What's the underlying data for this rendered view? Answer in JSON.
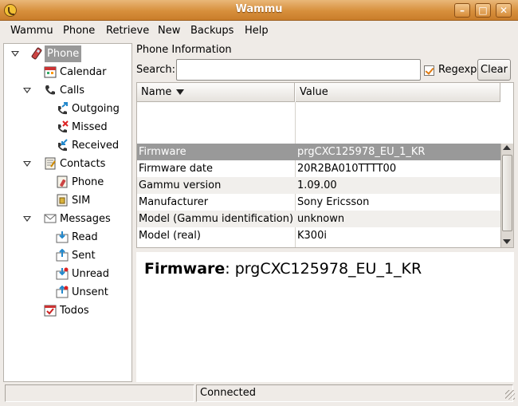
{
  "window": {
    "title": "Wammu"
  },
  "menubar": [
    "Wammu",
    "Phone",
    "Retrieve",
    "New",
    "Backups",
    "Help"
  ],
  "tree": [
    {
      "label": "Phone",
      "level": 0,
      "expander": true,
      "icon": "phone-icon",
      "selected": true
    },
    {
      "label": "Calendar",
      "level": 1,
      "icon": "calendar-icon"
    },
    {
      "label": "Calls",
      "level": 0,
      "expander": true,
      "icon": "calls-icon"
    },
    {
      "label": "Outgoing",
      "level": 1,
      "icon": "outgoing-call-icon"
    },
    {
      "label": "Missed",
      "level": 1,
      "icon": "missed-call-icon"
    },
    {
      "label": "Received",
      "level": 1,
      "icon": "received-call-icon"
    },
    {
      "label": "Contacts",
      "level": 0,
      "expander": true,
      "icon": "contacts-icon"
    },
    {
      "label": "Phone",
      "level": 1,
      "icon": "phone-contacts-icon"
    },
    {
      "label": "SIM",
      "level": 1,
      "icon": "sim-contacts-icon"
    },
    {
      "label": "Messages",
      "level": 0,
      "expander": true,
      "icon": "messages-icon"
    },
    {
      "label": "Read",
      "level": 1,
      "icon": "read-message-icon"
    },
    {
      "label": "Sent",
      "level": 1,
      "icon": "sent-message-icon"
    },
    {
      "label": "Unread",
      "level": 1,
      "icon": "unread-message-icon"
    },
    {
      "label": "Unsent",
      "level": 1,
      "icon": "unsent-message-icon"
    },
    {
      "label": "Todos",
      "level": 0,
      "icon": "todos-icon"
    }
  ],
  "main": {
    "section_title": "Phone Information",
    "search": {
      "label": "Search:",
      "value": ""
    },
    "regexp": {
      "label": "Regexp",
      "checked": true
    },
    "clear_label": "Clear",
    "columns": [
      "Name",
      "Value"
    ],
    "rows": [
      {
        "name": "Firmware",
        "value": "prgCXC125978_EU_1_KR",
        "selected": true
      },
      {
        "name": "Firmware date",
        "value": "20R2BA010TTTT00"
      },
      {
        "name": "Gammu version",
        "value": "1.09.00"
      },
      {
        "name": "Manufacturer",
        "value": "Sony Ericsson"
      },
      {
        "name": "Model (Gammu identification)",
        "value": "unknown"
      },
      {
        "name": "Model (real)",
        "value": "K300i"
      }
    ],
    "detail": {
      "key": "Firmware",
      "value": "prgCXC125978_EU_1_KR"
    }
  },
  "statusbar": {
    "left": "",
    "right": "Connected"
  },
  "colors": {
    "title_bar": "#d78f3c",
    "selection": "#999999",
    "regexp_check": "#e07a10"
  }
}
